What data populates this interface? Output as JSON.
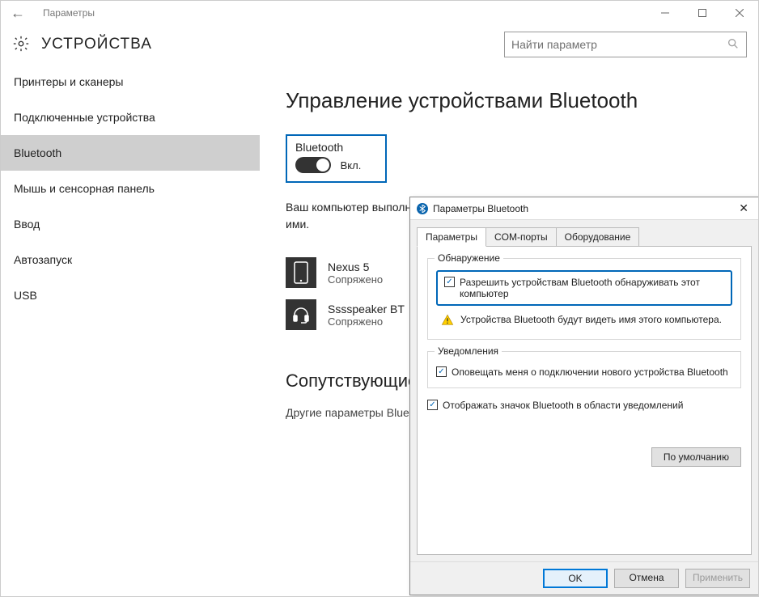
{
  "window": {
    "title": "Параметры"
  },
  "header": {
    "page_title": "УСТРОЙСТВА",
    "search_placeholder": "Найти параметр"
  },
  "sidebar": {
    "items": [
      {
        "label": "Принтеры и сканеры",
        "selected": false
      },
      {
        "label": "Подключенные устройства",
        "selected": false
      },
      {
        "label": "Bluetooth",
        "selected": true
      },
      {
        "label": "Мышь и сенсорная панель",
        "selected": false
      },
      {
        "label": "Ввод",
        "selected": false
      },
      {
        "label": "Автозапуск",
        "selected": false
      },
      {
        "label": "USB",
        "selected": false
      }
    ]
  },
  "main": {
    "heading": "Управление устройствами Bluetooth",
    "toggle_label": "Bluetooth",
    "toggle_state_text": "Вкл.",
    "description": "Ваш компьютер выполняет поиск устройств Bluetooth и может быть обнаружен ими.",
    "devices": [
      {
        "name": "Nexus 5",
        "status": "Сопряжено",
        "icon": "phone"
      },
      {
        "name": "Sssspeaker BT",
        "status": "Сопряжено",
        "icon": "headset"
      }
    ],
    "related_heading": "Сопутствующие параметры",
    "related_link": "Другие параметры Bluetooth"
  },
  "dialog": {
    "title": "Параметры Bluetooth",
    "tabs": [
      {
        "label": "Параметры",
        "active": true
      },
      {
        "label": "COM-порты",
        "active": false
      },
      {
        "label": "Оборудование",
        "active": false
      }
    ],
    "group_discovery": {
      "legend": "Обнаружение",
      "allow_checkbox": "Разрешить устройствам Bluetooth обнаруживать этот компьютер",
      "allow_checked": true,
      "warning_text": "Устройства Bluetooth будут видеть имя этого компьютера."
    },
    "group_notify": {
      "legend": "Уведомления",
      "notify_checkbox": "Оповещать меня о подключении нового устройства Bluetooth",
      "notify_checked": true
    },
    "tray_checkbox": {
      "label": "Отображать значок Bluetooth в области уведомлений",
      "checked": true
    },
    "restore_defaults": "По умолчанию",
    "buttons": {
      "ok": "OK",
      "cancel": "Отмена",
      "apply": "Применить"
    }
  }
}
